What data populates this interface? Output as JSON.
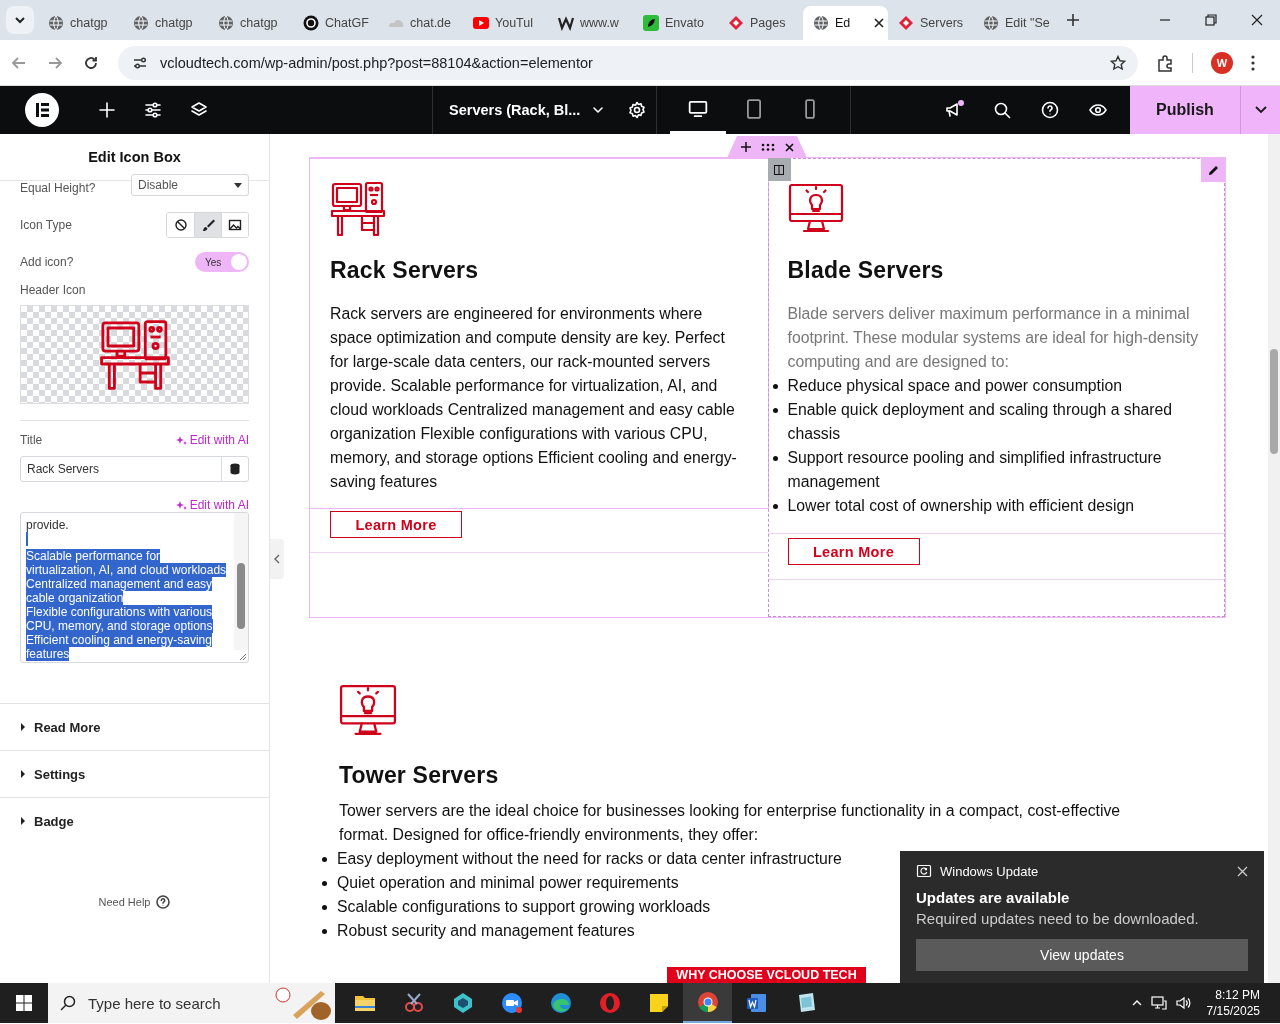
{
  "browser": {
    "tabs": [
      {
        "label": "chatgp",
        "kind": "globe",
        "selected": false
      },
      {
        "label": "chatgp",
        "kind": "globe",
        "selected": false
      },
      {
        "label": "chatgp",
        "kind": "globe",
        "selected": false
      },
      {
        "label": "ChatGF",
        "kind": "ring",
        "selected": false
      },
      {
        "label": "chat.de",
        "kind": "cloud",
        "selected": false
      },
      {
        "label": "YouTul",
        "kind": "play",
        "selected": false
      },
      {
        "label": "www.w",
        "kind": "zigzag",
        "selected": false
      },
      {
        "label": "Envato",
        "kind": "leaf",
        "selected": false
      },
      {
        "label": "Pages",
        "kind": "diamond",
        "selected": false
      },
      {
        "label": "Ed",
        "kind": "globe",
        "selected": true
      },
      {
        "label": "Servers",
        "kind": "diamond",
        "selected": false
      },
      {
        "label": "Edit \"Se",
        "kind": "globe",
        "selected": false
      }
    ],
    "address": "vcloudtech.com/wp-admin/post.php?post=88104&action=elementor",
    "profile_initial": "W"
  },
  "toolbar": {
    "document_title": "Servers (Rack, Bl...",
    "devices": [
      {
        "kind": "desktop",
        "selected": true
      },
      {
        "kind": "tablet",
        "selected": false
      },
      {
        "kind": "mobile",
        "selected": false
      }
    ],
    "publish": "Publish",
    "has_notification": true
  },
  "panel": {
    "title": "Edit Icon Box",
    "equal_height": {
      "label": "Equal Height?",
      "value": "Disable"
    },
    "icon_type": {
      "label": "Icon Type",
      "options": [
        {
          "kind": "none",
          "selected": false
        },
        {
          "kind": "brush",
          "selected": true
        },
        {
          "kind": "image",
          "selected": false
        }
      ]
    },
    "add_icon": {
      "label": "Add icon?",
      "on": true,
      "text": "Yes"
    },
    "header_icon": {
      "label": "Header Icon"
    },
    "title_field": {
      "label": "Title",
      "ai": "Edit with AI",
      "value": "Rack Servers"
    },
    "description": {
      "ai": "Edit with AI",
      "lines": [
        {
          "text": "provide.",
          "selected": false
        },
        {
          "selected": true
        },
        {
          "text": "Scalable performance for",
          "selected": true
        },
        {
          "text": "virtualization, AI, and cloud workloads",
          "selected": true
        },
        {
          "text": "Centralized management and easy",
          "selected": true
        },
        {
          "text": "cable organization",
          "selected": true
        },
        {
          "text": "Flexible configurations with various",
          "selected": true
        },
        {
          "text": "CPU, memory, and storage options",
          "selected": true
        },
        {
          "text": "Efficient cooling and energy-saving",
          "selected": true
        },
        {
          "text": "features",
          "selected": true
        }
      ]
    },
    "sections": [
      {
        "label": "Read More",
        "expanded": false
      },
      {
        "label": "Settings",
        "expanded": false
      },
      {
        "label": "Badge",
        "expanded": false
      }
    ],
    "help": "Need Help"
  },
  "canvas": {
    "boxes": [
      {
        "kind": "desk",
        "title": "Rack Servers",
        "paragraph": "Rack servers are engineered for environments where space optimization and compute density are key. Perfect for large-scale data centers, our rack-mounted servers provide. Scalable performance for virtualization, AI, and cloud workloads Centralized management and easy cable organization Flexible configurations with various CPU, memory, and storage options Efficient cooling and energy-saving features",
        "button": "Learn More",
        "selected": true,
        "column_active": false
      },
      {
        "kind": "monitor",
        "title": "Blade Servers",
        "paragraph": "Blade servers deliver maximum performance in a minimal footprint. These modular systems are ideal for high-density computing and are designed to:",
        "bullets": [
          "Reduce physical space and power consumption",
          "Enable quick deployment and scaling through a shared chassis",
          "Support resource pooling and simplified infrastructure management",
          "Lower total cost of ownership with efficient design"
        ],
        "button": "Learn More",
        "selected": false,
        "column_active": true
      }
    ],
    "tower": {
      "title": "Tower Servers",
      "paragraph": "Tower servers are the ideal choice for businesses looking for enterprise functionality in a compact, cost-effective format. Designed for office-friendly environments, they offer:",
      "bullets": [
        "Easy deployment without the need for racks or data center infrastructure",
        "Quiet operation and minimal power requirements",
        "Scalable configurations to support growing workloads",
        "Robust security and management features"
      ]
    },
    "banner": "WHY CHOOSE VCLOUD TECH"
  },
  "notification": {
    "app": "Windows Update",
    "title": "Updates are available",
    "message": "Required updates need to be downloaded.",
    "button": "View updates"
  },
  "taskbar": {
    "search_placeholder": "Type here to search",
    "apps": [
      {
        "kind": "folder",
        "active": false
      },
      {
        "kind": "snip",
        "active": false
      },
      {
        "kind": "gem",
        "active": false
      },
      {
        "kind": "zoom",
        "active": false
      },
      {
        "kind": "edge",
        "active": false
      },
      {
        "kind": "opera",
        "active": false
      },
      {
        "kind": "note",
        "active": false
      },
      {
        "kind": "chrome",
        "active": true
      },
      {
        "kind": "word",
        "active": false
      },
      {
        "kind": "sheet",
        "active": false
      }
    ],
    "time": "8:12 PM",
    "date": "7/15/2025"
  }
}
